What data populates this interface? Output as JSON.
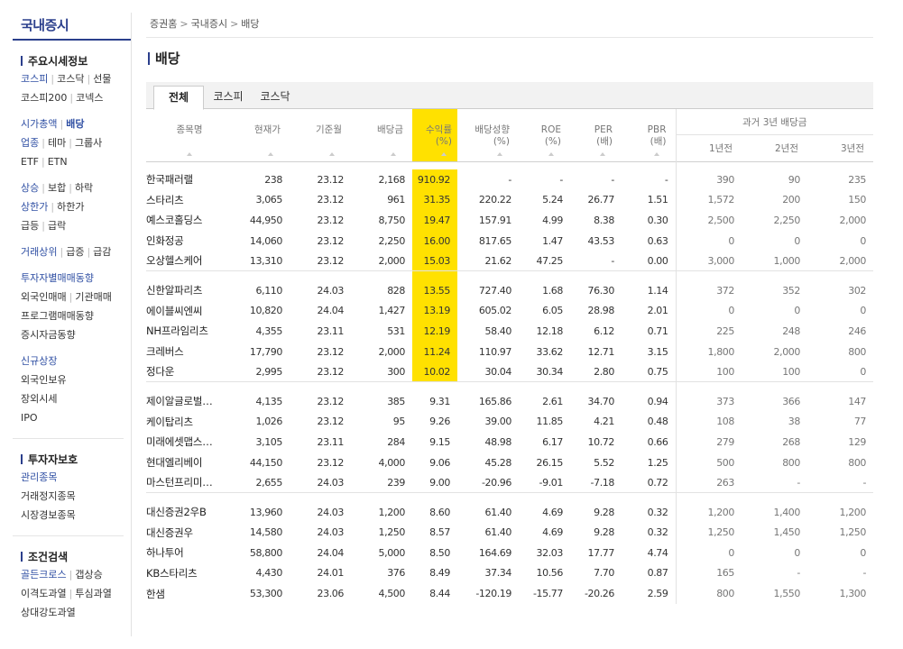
{
  "sidebar": {
    "logo": "국내증시",
    "sections": [
      {
        "title": "주요시세정보",
        "lines": [
          [
            {
              "t": "코스피",
              "c": "blue"
            },
            {
              "t": "코스닥",
              "c": "lnk"
            },
            {
              "t": "선물",
              "c": "lnk"
            }
          ],
          [
            {
              "t": "코스피200",
              "c": "lnk"
            },
            {
              "t": "코넥스",
              "c": "lnk"
            }
          ],
          "gap",
          [
            {
              "t": "시가총액",
              "c": "blue"
            },
            {
              "t": "배당",
              "c": "bold"
            }
          ],
          [
            {
              "t": "업종",
              "c": "blue"
            },
            {
              "t": "테마",
              "c": "lnk"
            },
            {
              "t": "그룹사",
              "c": "lnk"
            }
          ],
          [
            {
              "t": "ETF",
              "c": "lnk"
            },
            {
              "t": "ETN",
              "c": "lnk"
            }
          ],
          "gap",
          [
            {
              "t": "상승",
              "c": "blue"
            },
            {
              "t": "보합",
              "c": "lnk"
            },
            {
              "t": "하락",
              "c": "lnk"
            }
          ],
          [
            {
              "t": "상한가",
              "c": "blue"
            },
            {
              "t": "하한가",
              "c": "lnk"
            }
          ],
          [
            {
              "t": "급등",
              "c": "lnk"
            },
            {
              "t": "급락",
              "c": "lnk"
            }
          ],
          "gap",
          [
            {
              "t": "거래상위",
              "c": "blue"
            },
            {
              "t": "급증",
              "c": "lnk"
            },
            {
              "t": "급감",
              "c": "lnk"
            }
          ],
          "gap",
          [
            {
              "t": "투자자별매매동향",
              "c": "blue"
            }
          ],
          [
            {
              "t": "외국인매매",
              "c": "lnk"
            },
            {
              "t": "기관매매",
              "c": "lnk"
            }
          ],
          [
            {
              "t": "프로그램매매동향",
              "c": "lnk"
            }
          ],
          [
            {
              "t": "증시자금동향",
              "c": "lnk"
            }
          ],
          "gap",
          [
            {
              "t": "신규상장",
              "c": "blue"
            }
          ],
          [
            {
              "t": "외국인보유",
              "c": "lnk"
            }
          ],
          [
            {
              "t": "장외시세",
              "c": "lnk"
            }
          ],
          [
            {
              "t": "IPO",
              "c": "lnk"
            }
          ]
        ]
      },
      {
        "title": "투자자보호",
        "lines": [
          [
            {
              "t": "관리종목",
              "c": "blue"
            }
          ],
          [
            {
              "t": "거래정지종목",
              "c": "lnk"
            }
          ],
          [
            {
              "t": "시장경보종목",
              "c": "lnk"
            }
          ]
        ]
      },
      {
        "title": "조건검색",
        "lines": [
          [
            {
              "t": "골든크로스",
              "c": "blue"
            },
            {
              "t": "갭상승",
              "c": "lnk"
            }
          ],
          [
            {
              "t": "이격도과열",
              "c": "lnk"
            },
            {
              "t": "투심과열",
              "c": "lnk"
            }
          ],
          [
            {
              "t": "상대강도과열",
              "c": "lnk"
            }
          ]
        ]
      }
    ]
  },
  "breadcrumb": [
    "증권홈",
    "국내증시",
    "배당"
  ],
  "page_title": "배당",
  "tabs": [
    "전체",
    "코스피",
    "코스닥"
  ],
  "columns": {
    "name": "종목명",
    "price": "현재가",
    "base": "기준월",
    "dividend": "배당금",
    "yield": "수익률\n(%)",
    "payout": "배당성향\n(%)",
    "roe": "ROE\n(%)",
    "per": "PER\n(배)",
    "pbr": "PBR\n(배)",
    "past": "과거 3년 배당금",
    "y1": "1년전",
    "y2": "2년전",
    "y3": "3년전"
  },
  "groups": [
    [
      [
        "한국패러랠",
        "238",
        "23.12",
        "2,168",
        "910.92",
        "-",
        "-",
        "-",
        "-",
        "390",
        "90",
        "235"
      ],
      [
        "스타리츠",
        "3,065",
        "23.12",
        "961",
        "31.35",
        "220.22",
        "5.24",
        "26.77",
        "1.51",
        "1,572",
        "200",
        "150"
      ],
      [
        "예스코홀딩스",
        "44,950",
        "23.12",
        "8,750",
        "19.47",
        "157.91",
        "4.99",
        "8.38",
        "0.30",
        "2,500",
        "2,250",
        "2,000"
      ],
      [
        "인화정공",
        "14,060",
        "23.12",
        "2,250",
        "16.00",
        "817.65",
        "1.47",
        "43.53",
        "0.63",
        "0",
        "0",
        "0"
      ],
      [
        "오상헬스케어",
        "13,310",
        "23.12",
        "2,000",
        "15.03",
        "21.62",
        "47.25",
        "-",
        "0.00",
        "3,000",
        "1,000",
        "2,000"
      ]
    ],
    [
      [
        "신한알파리츠",
        "6,110",
        "24.03",
        "828",
        "13.55",
        "727.40",
        "1.68",
        "76.30",
        "1.14",
        "372",
        "352",
        "302"
      ],
      [
        "에이블씨엔씨",
        "10,820",
        "24.04",
        "1,427",
        "13.19",
        "605.02",
        "6.05",
        "28.98",
        "2.01",
        "0",
        "0",
        "0"
      ],
      [
        "NH프라임리츠",
        "4,355",
        "23.11",
        "531",
        "12.19",
        "58.40",
        "12.18",
        "6.12",
        "0.71",
        "225",
        "248",
        "246"
      ],
      [
        "크레버스",
        "17,790",
        "23.12",
        "2,000",
        "11.24",
        "110.97",
        "33.62",
        "12.71",
        "3.15",
        "1,800",
        "2,000",
        "800"
      ],
      [
        "정다운",
        "2,995",
        "23.12",
        "300",
        "10.02",
        "30.04",
        "30.34",
        "2.80",
        "0.75",
        "100",
        "100",
        "0"
      ]
    ],
    [
      [
        "제이알글로벌…",
        "4,135",
        "23.12",
        "385",
        "9.31",
        "165.86",
        "2.61",
        "34.70",
        "0.94",
        "373",
        "366",
        "147"
      ],
      [
        "케이탑리츠",
        "1,026",
        "23.12",
        "95",
        "9.26",
        "39.00",
        "11.85",
        "4.21",
        "0.48",
        "108",
        "38",
        "77"
      ],
      [
        "미래에셋맵스…",
        "3,105",
        "23.11",
        "284",
        "9.15",
        "48.98",
        "6.17",
        "10.72",
        "0.66",
        "279",
        "268",
        "129"
      ],
      [
        "현대엘리베이",
        "44,150",
        "23.12",
        "4,000",
        "9.06",
        "45.28",
        "26.15",
        "5.52",
        "1.25",
        "500",
        "800",
        "800"
      ],
      [
        "마스턴프리미…",
        "2,655",
        "24.03",
        "239",
        "9.00",
        "-20.96",
        "-9.01",
        "-7.18",
        "0.72",
        "263",
        "-",
        "-"
      ]
    ],
    [
      [
        "대신증권2우B",
        "13,960",
        "24.03",
        "1,200",
        "8.60",
        "61.40",
        "4.69",
        "9.28",
        "0.32",
        "1,200",
        "1,400",
        "1,200"
      ],
      [
        "대신증권우",
        "14,580",
        "24.03",
        "1,250",
        "8.57",
        "61.40",
        "4.69",
        "9.28",
        "0.32",
        "1,250",
        "1,450",
        "1,250"
      ],
      [
        "하나투어",
        "58,800",
        "24.04",
        "5,000",
        "8.50",
        "164.69",
        "32.03",
        "17.77",
        "4.74",
        "0",
        "0",
        "0"
      ],
      [
        "KB스타리츠",
        "4,430",
        "24.01",
        "376",
        "8.49",
        "37.34",
        "10.56",
        "7.70",
        "0.87",
        "165",
        "-",
        "-"
      ],
      [
        "한샘",
        "53,300",
        "23.06",
        "4,500",
        "8.44",
        "-120.19",
        "-15.77",
        "-20.26",
        "2.59",
        "800",
        "1,550",
        "1,300"
      ]
    ]
  ],
  "highlight_color": "#ffe100",
  "highlighted_rows": 10
}
